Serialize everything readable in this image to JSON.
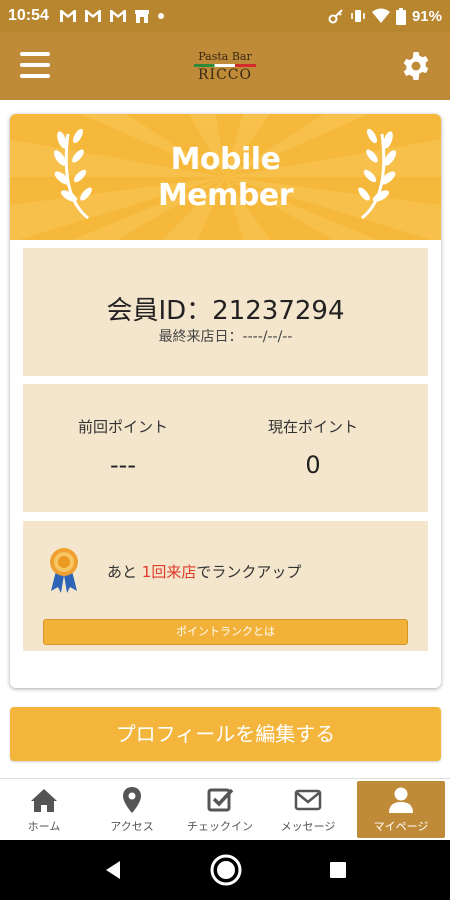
{
  "status_bar": {
    "time": "10:54",
    "battery": "91%",
    "left_icons": [
      "gmail-icon",
      "gmail-icon",
      "gmail-icon",
      "store-icon",
      "dot-icon"
    ],
    "right_icons": [
      "key-icon",
      "vibrate-icon",
      "wifi-icon",
      "battery-icon"
    ]
  },
  "header": {
    "logo_small": "Pasta Bar",
    "logo_big": "RICCO",
    "menu_icon": "hamburger-menu-icon",
    "settings_icon": "gear-icon"
  },
  "banner": {
    "line1": "Mobile",
    "line2": "Member",
    "decoration": "laurel-icon",
    "background": "#f5b83a"
  },
  "member": {
    "id_text": "会員ID：21237294",
    "last_visit": "最終来店日：----/--/--"
  },
  "points": {
    "previous_label": "前回ポイント",
    "previous_value": "---",
    "current_label": "現在ポイント",
    "current_value": "0"
  },
  "rank": {
    "prefix": "あと",
    "highlight": "1回来店",
    "suffix": "でランクアップ",
    "button": "ポイントランクとは",
    "highlight_color": "#e03a2a"
  },
  "edit_profile": "プロフィールを編集する",
  "nav": [
    {
      "label": "ホーム",
      "icon": "home-icon"
    },
    {
      "label": "アクセス",
      "icon": "map-pin-icon"
    },
    {
      "label": "チェックイン",
      "icon": "checkbox-icon"
    },
    {
      "label": "メッセージ",
      "icon": "envelope-icon"
    },
    {
      "label": "マイページ",
      "icon": "person-icon",
      "active": true
    }
  ],
  "colors": {
    "header": "#c08b38",
    "accent": "#f3b53c",
    "panel": "#f3e6cd"
  }
}
